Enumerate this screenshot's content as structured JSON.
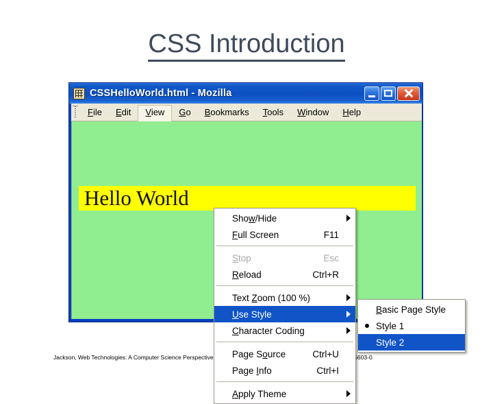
{
  "slide": {
    "title": "CSS Introduction",
    "title_color": "#3e4a5c",
    "footer": "Jackson, Web Technologies: A Computer Science Perspective, © 2007 Prentice-Hall, Inc. All rights reserved. 0-13-185603-0"
  },
  "browser": {
    "titlebar": {
      "text": "CSSHelloWorld.html - Mozilla",
      "icon": "document-grid-icon",
      "bg_color": "#0d4fc2",
      "buttons": [
        {
          "name": "minimize",
          "glyph": "_"
        },
        {
          "name": "maximize",
          "glyph": "□"
        },
        {
          "name": "close",
          "glyph": "✕"
        }
      ]
    },
    "menubar": {
      "items": [
        {
          "label": "File",
          "accesskey": "F",
          "active": false
        },
        {
          "label": "Edit",
          "accesskey": "E",
          "active": false
        },
        {
          "label": "View",
          "accesskey": "V",
          "active": true
        },
        {
          "label": "Go",
          "accesskey": "G",
          "active": false
        },
        {
          "label": "Bookmarks",
          "accesskey": "B",
          "active": false
        },
        {
          "label": "Tools",
          "accesskey": "T",
          "active": false
        },
        {
          "label": "Window",
          "accesskey": "W",
          "active": false
        },
        {
          "label": "Help",
          "accesskey": "H",
          "active": false
        }
      ]
    },
    "page": {
      "background_color": "#90ee90",
      "heading_text": "Hello World",
      "heading_background": "#ffff00"
    }
  },
  "view_menu": {
    "items": [
      {
        "type": "item",
        "label": "Show/Hide",
        "accesskey": "w",
        "accel": "",
        "submenu": true,
        "disabled": false,
        "highlight": false,
        "radio": false
      },
      {
        "type": "item",
        "label": "Full Screen",
        "accesskey": "F",
        "accel": "F11",
        "submenu": false,
        "disabled": false,
        "highlight": false,
        "radio": false
      },
      {
        "type": "separator"
      },
      {
        "type": "item",
        "label": "Stop",
        "accesskey": "S",
        "accel": "Esc",
        "submenu": false,
        "disabled": true,
        "highlight": false,
        "radio": false
      },
      {
        "type": "item",
        "label": "Reload",
        "accesskey": "R",
        "accel": "Ctrl+R",
        "submenu": false,
        "disabled": false,
        "highlight": false,
        "radio": false
      },
      {
        "type": "separator"
      },
      {
        "type": "item",
        "label": "Text Zoom (100 %)",
        "accesskey": "Z",
        "accel": "",
        "submenu": true,
        "disabled": false,
        "highlight": false,
        "radio": false
      },
      {
        "type": "item",
        "label": "Use Style",
        "accesskey": "U",
        "accel": "",
        "submenu": true,
        "disabled": false,
        "highlight": true,
        "radio": false
      },
      {
        "type": "item",
        "label": "Character Coding",
        "accesskey": "C",
        "accel": "",
        "submenu": true,
        "disabled": false,
        "highlight": false,
        "radio": false
      },
      {
        "type": "separator"
      },
      {
        "type": "item",
        "label": "Page Source",
        "accesskey": "o",
        "accel": "Ctrl+U",
        "submenu": false,
        "disabled": false,
        "highlight": false,
        "radio": false
      },
      {
        "type": "item",
        "label": "Page Info",
        "accesskey": "I",
        "accel": "Ctrl+I",
        "submenu": false,
        "disabled": false,
        "highlight": false,
        "radio": false
      },
      {
        "type": "separator"
      },
      {
        "type": "item",
        "label": "Apply Theme",
        "accesskey": "A",
        "accel": "",
        "submenu": true,
        "disabled": false,
        "highlight": false,
        "radio": false
      }
    ]
  },
  "style_submenu": {
    "items": [
      {
        "type": "item",
        "label": "Basic Page Style",
        "accesskey": "B",
        "accel": "",
        "submenu": false,
        "disabled": false,
        "highlight": false,
        "radio": false
      },
      {
        "type": "item",
        "label": "Style 1",
        "accesskey": "",
        "accel": "",
        "submenu": false,
        "disabled": false,
        "highlight": false,
        "radio": true
      },
      {
        "type": "item",
        "label": "Style 2",
        "accesskey": "",
        "accel": "",
        "submenu": false,
        "disabled": false,
        "highlight": true,
        "radio": false
      }
    ]
  },
  "colors": {
    "menu_highlight": "#1054c8",
    "page_green": "#90ee90",
    "heading_yellow": "#ffff00",
    "titlebar_blue": "#0d4fc2",
    "menubar_beige": "#ece9d8"
  }
}
